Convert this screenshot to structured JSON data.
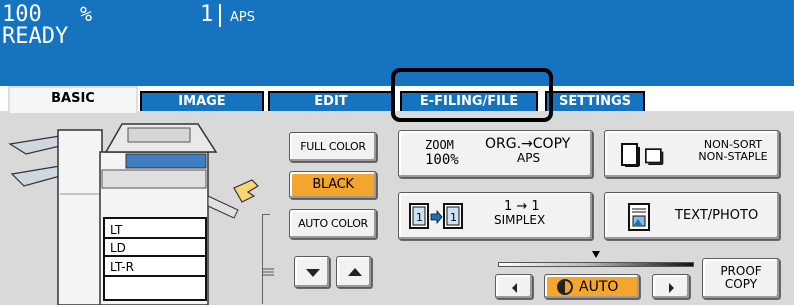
{
  "status_bar": {
    "zoom_value": "100",
    "zoom_unit": "%",
    "copies": "1",
    "paper": "APS",
    "status": "READY"
  },
  "tabs": [
    {
      "label": "BASIC",
      "selected": true
    },
    {
      "label": "IMAGE",
      "selected": false
    },
    {
      "label": "EDIT",
      "selected": false
    },
    {
      "label": "E-FILING/FILE",
      "selected": false,
      "highlighted": true
    },
    {
      "label": "SETTINGS",
      "selected": false
    }
  ],
  "color_mode": {
    "full_color": "FULL COLOR",
    "black": "BLACK",
    "auto_color": "AUTO COLOR",
    "selected": "BLACK"
  },
  "zoom_button": {
    "label": "ZOOM",
    "value": "100%",
    "org_copy": "ORG.→COPY",
    "paper": "APS"
  },
  "finishing_button": {
    "line1": "NON-SORT",
    "line2": "NON-STAPLE"
  },
  "duplex_button": {
    "arrow": "1 → 1",
    "mode": "SIMPLEX"
  },
  "original_mode_button": {
    "label": "TEXT/PHOTO"
  },
  "density": {
    "auto_label": "AUTO",
    "level": 0.5
  },
  "proof_button": {
    "line1": "PROOF",
    "line2": "COPY"
  },
  "drawers": [
    {
      "label": "LT"
    },
    {
      "label": "LD"
    },
    {
      "label": "LT-R"
    },
    {
      "label": ""
    }
  ],
  "colors": {
    "header_blue": "#1673bf",
    "panel_gray": "#d9d9d9",
    "selected_orange": "#f4a52c"
  },
  "icons": [
    "drawer-scroll-down-icon",
    "drawer-scroll-up-icon",
    "density-lighter-icon",
    "density-darker-icon",
    "auto-density-icon",
    "sort-icon",
    "duplex-icon",
    "text-photo-icon",
    "paper-stack-icon"
  ]
}
